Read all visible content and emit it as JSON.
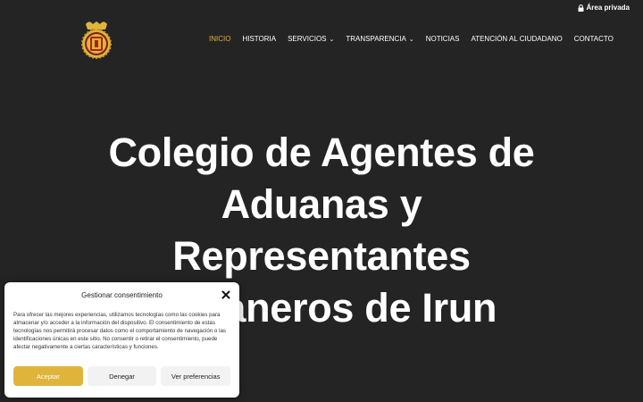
{
  "topbar": {
    "private_area": "Área privada"
  },
  "nav": {
    "items": [
      {
        "label": "INICIO",
        "active": true,
        "dropdown": false
      },
      {
        "label": "HISTORIA",
        "active": false,
        "dropdown": false
      },
      {
        "label": "SERVICIOS",
        "active": false,
        "dropdown": true
      },
      {
        "label": "TRANSPARENCIA",
        "active": false,
        "dropdown": true
      },
      {
        "label": "NOTICIAS",
        "active": false,
        "dropdown": false
      },
      {
        "label": "ATENCIÓN AL CIUDADANO",
        "active": false,
        "dropdown": false
      },
      {
        "label": "CONTACTO",
        "active": false,
        "dropdown": false
      }
    ]
  },
  "hero": {
    "lines": [
      "Colegio de Agentes de",
      "Aduanas y",
      "Representantes",
      "Aduaneros de Irun"
    ]
  },
  "consent": {
    "title": "Gestionar consentimiento",
    "text": "Para ofrecer las mejores experiencias, utilizamos tecnologías como las cookies para almacenar y/o acceder a la información del dispositivo. El consentimiento de estas tecnologías nos permitirá procesar datos como el comportamiento de navegación o las identificaciones únicas en este sitio. No consentir o retirar el consentimiento, puede afectar negativamente a ciertas características y funciones.",
    "accept": "Aceptar",
    "deny": "Denegar",
    "prefs": "Ver preferencias"
  },
  "colors": {
    "background": "#242424",
    "accent": "#e0b43a"
  }
}
